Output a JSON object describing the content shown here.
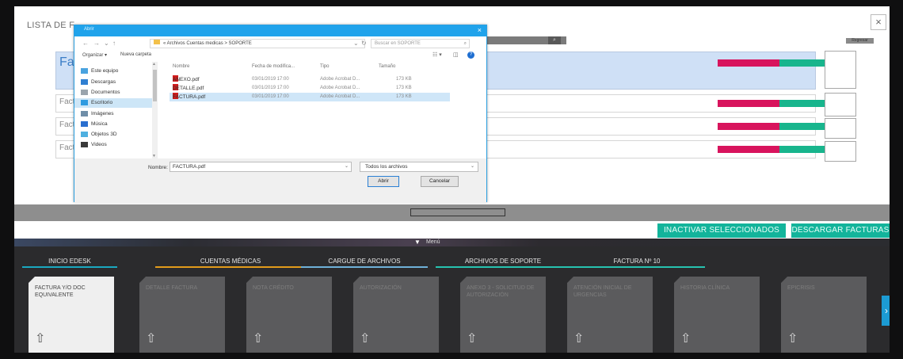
{
  "panel": {
    "title": "LISTA DE F",
    "close_label": "×",
    "right_mini_label": "Regresar"
  },
  "rows": [
    {
      "name": "Fa SC",
      "status_red": "",
      "status_green": ""
    },
    {
      "name": "Fact SOP",
      "status_red": "",
      "status_green": ""
    },
    {
      "name": "Fact SOP",
      "status_red": "",
      "status_green": ""
    },
    {
      "name": "Fact SOP",
      "status_red": "",
      "status_green": ""
    }
  ],
  "actions": {
    "inactivar": "INACTIVAR SELECCIONADOS",
    "descargar": "DESCARGAR FACTURAS"
  },
  "menu": {
    "label": "Menú",
    "tabs": [
      {
        "label": "INICIO EDESK",
        "underline": "#1aa8c0"
      },
      {
        "label": "CUENTAS MÉDICAS",
        "underline": "#e39b1b"
      },
      {
        "label": "CARGUE DE ARCHIVOS",
        "underline": "#6fb1d9"
      },
      {
        "label": "ARCHIVOS DE SOPORTE",
        "underline": "#27c3b0"
      },
      {
        "label": "FACTURA Nº 10",
        "underline": "#27c3b0"
      }
    ],
    "cards": [
      {
        "label": "FACTURA Y/O DOC EQUIVALENTE",
        "active": true
      },
      {
        "label": "DETALLE FACTURA",
        "active": false
      },
      {
        "label": "NOTA CRÉDITO",
        "active": false
      },
      {
        "label": "AUTORIZACIÓN",
        "active": false
      },
      {
        "label": "ANEXO 3 - SOLICITUD DE AUTORIZACIÓN",
        "active": false
      },
      {
        "label": "ATENCIÓN INICIAL DE URGENCIAS",
        "active": false
      },
      {
        "label": "HISTORIA CLÍNICA",
        "active": false
      },
      {
        "label": "EPICRISIS",
        "active": false
      }
    ],
    "upload_glyph": "⇧",
    "next_arrow": "›"
  },
  "dialog": {
    "title": "Abrir",
    "close": "×",
    "nav": {
      "back": "←",
      "forward": "→",
      "down": "⌄",
      "up": "↑",
      "dropdown": "⌄",
      "refresh": "↻"
    },
    "address": "« Archivos Cuentas medicas  >  SOPORTE",
    "search_placeholder": "Buscar en SOPORTE",
    "toolbar": {
      "organize": "Organizar ▾",
      "new_folder": "Nueva carpeta",
      "view": "☷ ▾",
      "pane": "◫",
      "help": "?"
    },
    "nav_items": [
      {
        "label": "Este equipo",
        "selected": false,
        "color": "#4aa3df"
      },
      {
        "label": "Descargas",
        "selected": false,
        "color": "#2f7fd1"
      },
      {
        "label": "Documentos",
        "selected": false,
        "color": "#9aa4ad"
      },
      {
        "label": "Escritorio",
        "selected": true,
        "color": "#2f9be0"
      },
      {
        "label": "Imágenes",
        "selected": false,
        "color": "#6f8ea8"
      },
      {
        "label": "Música",
        "selected": false,
        "color": "#2a6fcf"
      },
      {
        "label": "Objetos 3D",
        "selected": false,
        "color": "#4fb0e0"
      },
      {
        "label": "Videos",
        "selected": false,
        "color": "#3a3a3a"
      }
    ],
    "columns": {
      "name": "Nombre",
      "date": "Fecha de modifica...",
      "type": "Tipo",
      "size": "Tamaño"
    },
    "files": [
      {
        "name": "ANEXO.pdf",
        "date": "03/01/2019 17:00",
        "type": "Adobe Acrobat D...",
        "size": "173 KB",
        "selected": false
      },
      {
        "name": "DETALLE.pdf",
        "date": "03/01/2019 17:00",
        "type": "Adobe Acrobat D...",
        "size": "173 KB",
        "selected": false
      },
      {
        "name": "FACTURA.pdf",
        "date": "03/01/2019 17:00",
        "type": "Adobe Acrobat D...",
        "size": "173 KB",
        "selected": true
      }
    ],
    "filename_label": "Nombre:",
    "filename_value": "FACTURA.pdf",
    "filetype_value": "Todos los archivos",
    "open_label": "Abrir",
    "cancel_label": "Cancelar"
  },
  "colors": {
    "accent_blue": "#20a3eb",
    "teal": "#13b49b",
    "badge_red": "#d8145d",
    "badge_green": "#18b58d",
    "row_highlight": "#cfe0f6"
  }
}
